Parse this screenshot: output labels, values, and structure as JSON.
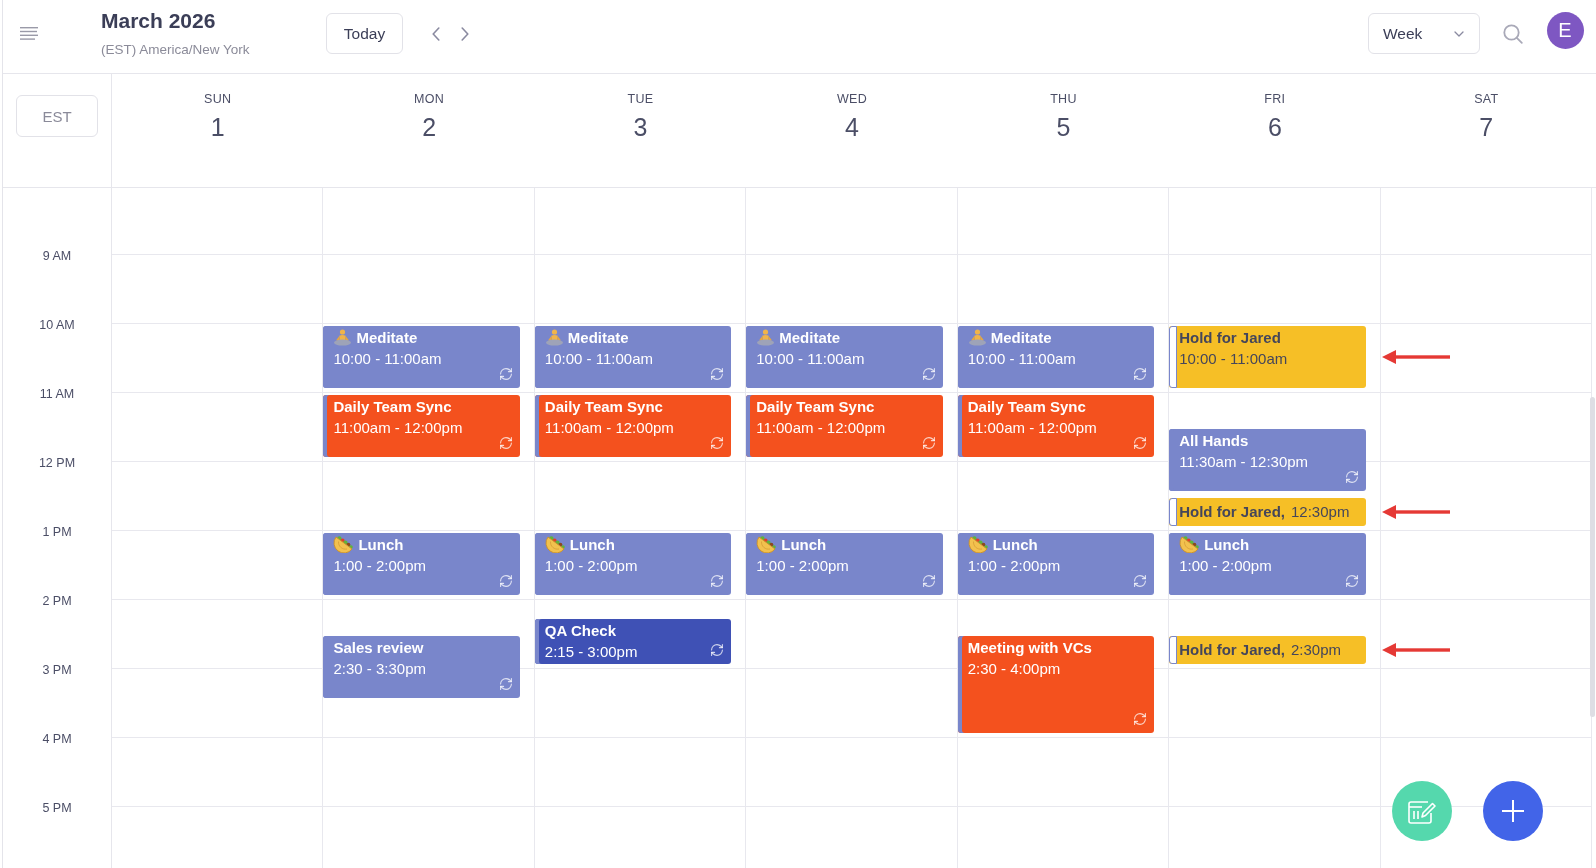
{
  "header": {
    "title": "March 2026",
    "timezone": "(EST) America/New York",
    "today_button": "Today",
    "view_select": {
      "value": "Week"
    },
    "avatar": {
      "initial": "E"
    }
  },
  "timezone_button": "EST",
  "days": [
    {
      "name": "SUN",
      "date": "1"
    },
    {
      "name": "MON",
      "date": "2",
      "events": [
        {
          "kind": "meditation",
          "title": "Meditate",
          "time": "10:00 - 11:00am",
          "color": "#7986cb",
          "recurring": true,
          "flagged": false
        },
        {
          "kind": "meeting",
          "title": "Daily Team Sync",
          "time": "11:00am - 12:00pm",
          "color": "#f4511e",
          "recurring": true,
          "flagged": false
        },
        {
          "kind": "meal",
          "title": "Lunch",
          "time": "1:00 - 2:00pm",
          "color": "#7986cb",
          "recurring": true,
          "flagged": false
        },
        {
          "kind": "meeting",
          "title": "Sales review",
          "time": "2:30 - 3:30pm",
          "color": "#7986cb",
          "recurring": true,
          "flagged": false
        }
      ]
    },
    {
      "name": "TUE",
      "date": "3",
      "events": [
        {
          "kind": "meditation",
          "title": "Meditate",
          "time": "10:00 - 11:00am",
          "color": "#7986cb",
          "recurring": true,
          "flagged": false
        },
        {
          "kind": "meeting",
          "title": "Daily Team Sync",
          "time": "11:00am - 12:00pm",
          "color": "#f4511e",
          "recurring": true,
          "flagged": false
        },
        {
          "kind": "meal",
          "title": "Lunch",
          "time": "1:00 - 2:00pm",
          "color": "#7986cb",
          "recurring": true,
          "flagged": false
        },
        {
          "kind": "meeting",
          "title": "QA Check",
          "time": "2:15 - 3:00pm",
          "color": "#3f51b5",
          "recurring": true,
          "flagged": false
        }
      ]
    },
    {
      "name": "WED",
      "date": "4",
      "events": [
        {
          "kind": "meditation",
          "title": "Meditate",
          "time": "10:00 - 11:00am",
          "color": "#7986cb",
          "recurring": true,
          "flagged": false
        },
        {
          "kind": "meeting",
          "title": "Daily Team Sync",
          "time": "11:00am - 12:00pm",
          "color": "#f4511e",
          "recurring": true,
          "flagged": false
        },
        {
          "kind": "meal",
          "title": "Lunch",
          "time": "1:00 - 2:00pm",
          "color": "#7986cb",
          "recurring": true,
          "flagged": false
        }
      ]
    },
    {
      "name": "THU",
      "date": "5",
      "events": [
        {
          "kind": "meditation",
          "title": "Meditate",
          "time": "10:00 - 11:00am",
          "color": "#7986cb",
          "recurring": true,
          "flagged": false
        },
        {
          "kind": "meeting",
          "title": "Daily Team Sync",
          "time": "11:00am - 12:00pm",
          "color": "#f4511e",
          "recurring": true,
          "flagged": false
        },
        {
          "kind": "meal",
          "title": "Lunch",
          "time": "1:00 - 2:00pm",
          "color": "#7986cb",
          "recurring": true,
          "flagged": false
        },
        {
          "kind": "meeting",
          "title": "Meeting with VCs",
          "time": "2:30 - 4:00pm",
          "color": "#f4511e",
          "recurring": true,
          "flagged": false
        }
      ]
    },
    {
      "name": "FRI",
      "date": "6",
      "events": [
        {
          "kind": "hold",
          "title": "Hold for Jared",
          "time": "10:00 - 11:00am",
          "color": "#f6bf26",
          "recurring": false,
          "flagged": true
        },
        {
          "kind": "meeting",
          "title": "All Hands",
          "time": "11:30am - 12:30pm",
          "color": "#7986cb",
          "recurring": true,
          "flagged": false
        },
        {
          "kind": "hold",
          "title": "Hold for Jared,",
          "time": "12:30pm",
          "color": "#f6bf26",
          "recurring": false,
          "flagged": true
        },
        {
          "kind": "meal",
          "title": "Lunch",
          "time": "1:00 - 2:00pm",
          "color": "#7986cb",
          "recurring": true,
          "flagged": false
        },
        {
          "kind": "hold",
          "title": "Hold for Jared,",
          "time": "2:30pm",
          "color": "#f6bf26",
          "recurring": false,
          "flagged": true
        }
      ]
    },
    {
      "name": "SAT",
      "date": "7"
    }
  ],
  "time_labels": [
    "9 AM",
    "10 AM",
    "11 AM",
    "12 PM",
    "1 PM",
    "2 PM",
    "3 PM",
    "4 PM",
    "5 PM"
  ]
}
